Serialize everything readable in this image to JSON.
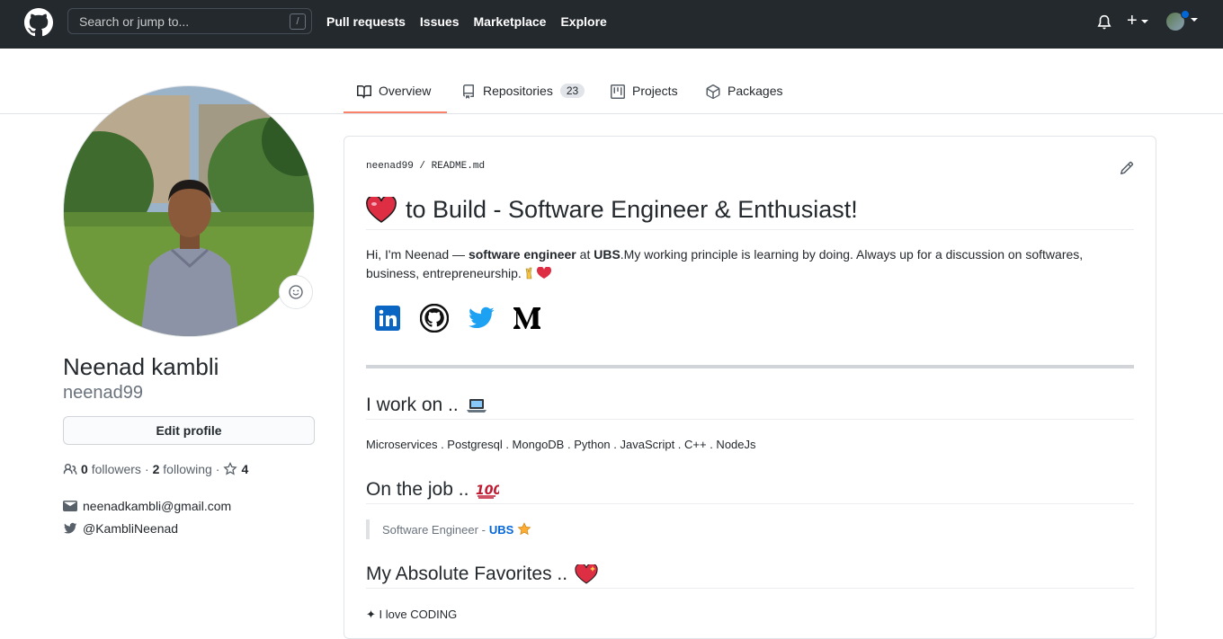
{
  "header": {
    "search_placeholder": "Search or jump to...",
    "search_shortcut": "/",
    "nav": [
      "Pull requests",
      "Issues",
      "Marketplace",
      "Explore"
    ],
    "plus_label": "+"
  },
  "tabs": [
    {
      "label": "Overview",
      "active": true
    },
    {
      "label": "Repositories",
      "count": "23"
    },
    {
      "label": "Projects"
    },
    {
      "label": "Packages"
    }
  ],
  "profile": {
    "full_name": "Neenad kambli",
    "username": "neenad99",
    "edit_label": "Edit profile",
    "followers_count": "0",
    "followers_label": "followers",
    "following_count": "2",
    "following_label": "following",
    "stars_count": "4",
    "email": "neenadkambli@gmail.com",
    "twitter": "@KambliNeenad"
  },
  "readme": {
    "owner": "neenad99",
    "separator": "/",
    "file": "README.md",
    "title": "to Build - Software Engineer & Enthusiast!",
    "intro_pre": "Hi, I'm Neenad — ",
    "intro_bold": "software engineer",
    "intro_mid": " at ",
    "intro_company": "UBS",
    "intro_post": ".My working principle is learning by doing. Always up for a discussion on softwares, business, entrepreneurship.",
    "social_icons": [
      "linkedin-icon",
      "github-icon",
      "twitter-icon",
      "medium-icon"
    ],
    "section_work": "I work on ..",
    "tech_list": "Microservices . Postgresql . MongoDB . Python . JavaScript . C++ . NodeJs",
    "section_job": "On the job ..",
    "job_role": "Software Engineer -",
    "job_company": "UBS",
    "section_fav": "My Absolute Favorites ..",
    "fav_line": "I love CODING"
  },
  "colors": {
    "header_bg": "#24292e",
    "tab_underline": "#f9826c",
    "link": "#0366d6"
  }
}
